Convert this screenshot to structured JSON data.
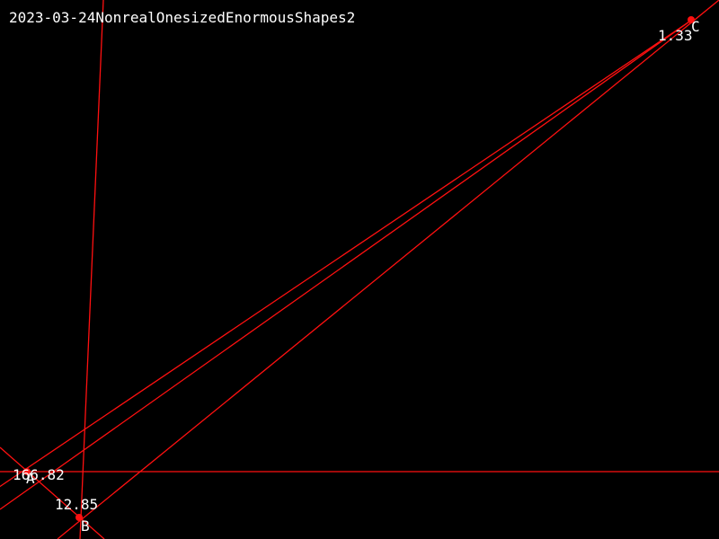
{
  "title": "2023-03-24NonrealOnesizedEnormousShapes2",
  "colors": {
    "background": "#000000",
    "line": "#ff1010",
    "text": "#ffffff"
  },
  "points": {
    "A": {
      "label": "A",
      "value": "166.82"
    },
    "B": {
      "label": "B",
      "value": "12.85"
    },
    "C": {
      "label": "C",
      "value": "1.33"
    }
  }
}
